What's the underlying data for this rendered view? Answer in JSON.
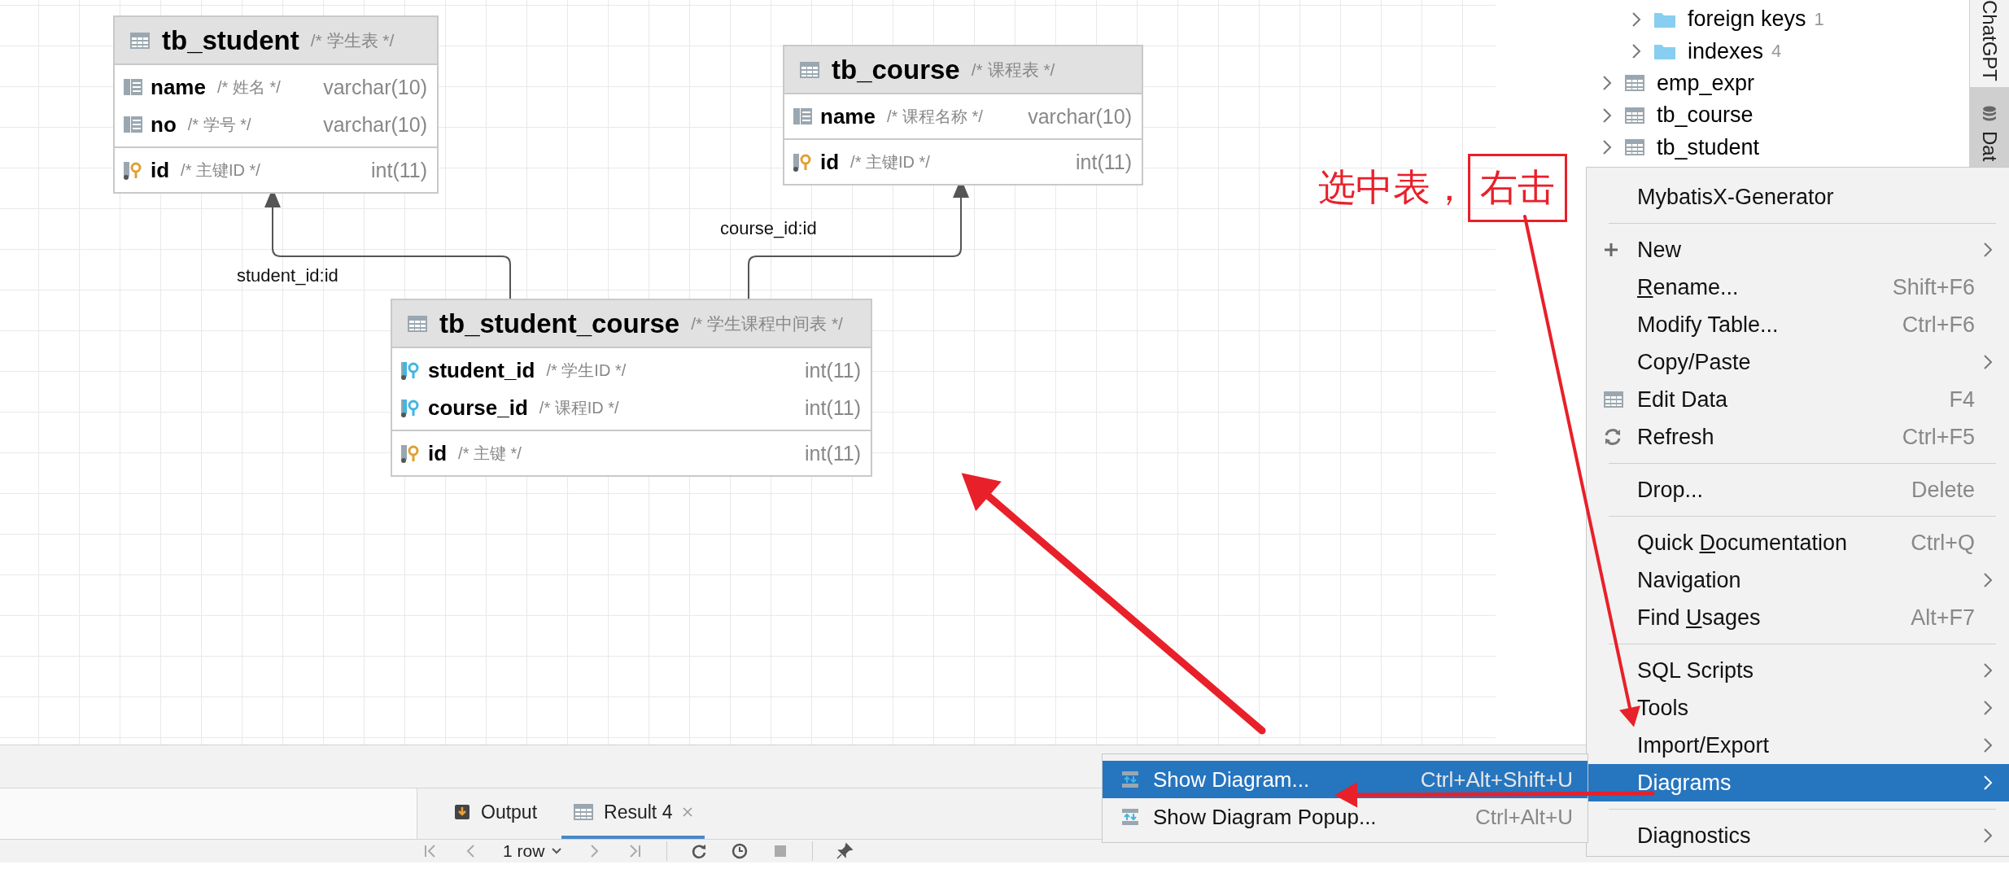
{
  "diagram": {
    "tables": [
      {
        "name": "tb_student",
        "comment": "/* 学生表 */",
        "column_groups": [
          {
            "columns": [
              {
                "name": "name",
                "comment": "/* 姓名 */",
                "type": "varchar(10)",
                "kind": "column"
              },
              {
                "name": "no",
                "comment": "/* 学号 */",
                "type": "varchar(10)",
                "kind": "column"
              }
            ]
          },
          {
            "columns": [
              {
                "name": "id",
                "comment": "/* 主键ID */",
                "type": "int(11)",
                "kind": "primary_key"
              }
            ]
          }
        ]
      },
      {
        "name": "tb_course",
        "comment": "/* 课程表 */",
        "column_groups": [
          {
            "columns": [
              {
                "name": "name",
                "comment": "/* 课程名称 */",
                "type": "varchar(10)",
                "kind": "column"
              }
            ]
          },
          {
            "columns": [
              {
                "name": "id",
                "comment": "/* 主键ID */",
                "type": "int(11)",
                "kind": "primary_key"
              }
            ]
          }
        ]
      },
      {
        "name": "tb_student_course",
        "comment": "/* 学生课程中间表 */",
        "column_groups": [
          {
            "columns": [
              {
                "name": "student_id",
                "comment": "/* 学生ID */",
                "type": "int(11)",
                "kind": "foreign_key"
              },
              {
                "name": "course_id",
                "comment": "/* 课程ID */",
                "type": "int(11)",
                "kind": "foreign_key"
              }
            ]
          },
          {
            "columns": [
              {
                "name": "id",
                "comment": "/* 主键 */",
                "type": "int(11)",
                "kind": "primary_key"
              }
            ]
          }
        ]
      }
    ],
    "relations": [
      {
        "label": "student_id:id"
      },
      {
        "label": "course_id:id"
      }
    ]
  },
  "tree": {
    "items": [
      {
        "children": [
          {
            "label": "foreign keys",
            "count": "1",
            "kind": "folder"
          },
          {
            "label": "indexes",
            "count": "4",
            "kind": "folder"
          }
        ]
      },
      {
        "label": "emp_expr",
        "kind": "table"
      },
      {
        "label": "tb_course",
        "kind": "table"
      },
      {
        "label": "tb_student",
        "kind": "table"
      }
    ]
  },
  "side_strip": {
    "tabs": [
      {
        "label": "ChatGPT",
        "kind": "text",
        "selected": false
      },
      {
        "label": "Dat",
        "kind": "database",
        "selected": true
      }
    ]
  },
  "bottom_tabs": [
    {
      "label": "Output",
      "kind": "output",
      "selected": false,
      "closable": false
    },
    {
      "label": "Result 4",
      "kind": "result",
      "selected": true,
      "closable": true
    }
  ],
  "toolbar": {
    "rows": "1 row"
  },
  "context_menu": {
    "items": [
      {
        "kind": "item",
        "label": "MybatisX-Generator",
        "submenu": false,
        "selected": false
      },
      {
        "kind": "separator"
      },
      {
        "kind": "add_item",
        "label": "New",
        "submenu": true,
        "selected": false
      },
      {
        "kind": "item",
        "mnemonic": "R",
        "label_after": "ename...",
        "shortcut": "Shift+F6",
        "submenu": false,
        "selected": false
      },
      {
        "kind": "item",
        "label": "Modify Table...",
        "shortcut": "Ctrl+F6",
        "submenu": false,
        "selected": false
      },
      {
        "kind": "item",
        "label": "Copy/Paste",
        "submenu": true,
        "selected": false
      },
      {
        "kind": "data_item",
        "label": "Edit Data",
        "shortcut": "F4",
        "submenu": false,
        "selected": false
      },
      {
        "kind": "refresh_item",
        "label": "Refresh",
        "shortcut": "Ctrl+F5",
        "submenu": false,
        "selected": false
      },
      {
        "kind": "separator"
      },
      {
        "kind": "item",
        "label": "Drop...",
        "shortcut": "Delete",
        "submenu": false,
        "selected": false
      },
      {
        "kind": "separator"
      },
      {
        "kind": "item",
        "label_before": "Quick ",
        "mnemonic": "D",
        "label_after": "ocumentation",
        "shortcut": "Ctrl+Q",
        "submenu": false,
        "selected": false
      },
      {
        "kind": "item",
        "label": "Navigation",
        "submenu": true,
        "selected": false
      },
      {
        "kind": "item",
        "label_before": "Find ",
        "mnemonic": "U",
        "label_after": "sages",
        "shortcut": "Alt+F7",
        "submenu": false,
        "selected": false
      },
      {
        "kind": "separator"
      },
      {
        "kind": "item",
        "label": "SQL Scripts",
        "submenu": true,
        "selected": false
      },
      {
        "kind": "item",
        "label": "Tools",
        "submenu": true,
        "selected": false
      },
      {
        "kind": "item",
        "label": "Import/Export",
        "submenu": true,
        "selected": false
      },
      {
        "kind": "item",
        "label": "Diagrams",
        "submenu": true,
        "selected": true
      },
      {
        "kind": "separator"
      },
      {
        "kind": "item",
        "label": "Diagnostics",
        "submenu": true,
        "selected": false
      }
    ]
  },
  "submenu": {
    "items": [
      {
        "label": "Show Diagram...",
        "shortcut": "Ctrl+Alt+Shift+U",
        "selected": true
      },
      {
        "label": "Show Diagram Popup...",
        "shortcut": "Ctrl+Alt+U",
        "selected": false
      }
    ]
  },
  "annotation": {
    "text": "选中表，",
    "boxed_text": "右击"
  }
}
